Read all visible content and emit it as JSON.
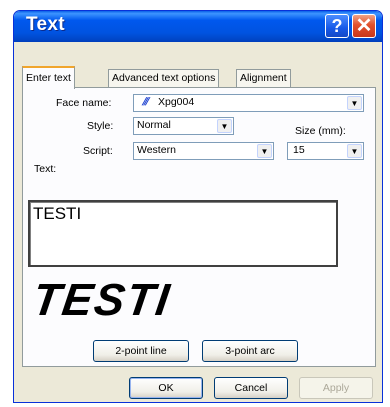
{
  "window": {
    "title": "Text",
    "help_glyph": "?",
    "close_glyph": "✕"
  },
  "tabs": [
    {
      "label": "Enter text",
      "active": true
    },
    {
      "label": "Advanced text options",
      "active": false
    },
    {
      "label": "Alignment",
      "active": false
    }
  ],
  "form": {
    "face_name_label": "Face name:",
    "face_name_icon": "embroidery-font-icon",
    "face_name_icon_glyph": "⫻",
    "face_name_value": "Xpg004",
    "style_label": "Style:",
    "style_value": "Normal",
    "size_label": "Size (mm):",
    "size_value": "15",
    "script_label": "Script:",
    "script_value": "Western",
    "text_label": "Text:",
    "text_value": "TESTI",
    "preview_text": "TESTI"
  },
  "buttons": {
    "two_point_line": "2-point line",
    "three_point_arc": "3-point arc",
    "ok": "OK",
    "cancel": "Cancel",
    "apply": "Apply"
  },
  "colors": {
    "titlebar": "#0055e5",
    "close_button": "#e2512d",
    "active_tab_highlight": "#f0a52c",
    "dialog_background": "#ece9d8"
  }
}
